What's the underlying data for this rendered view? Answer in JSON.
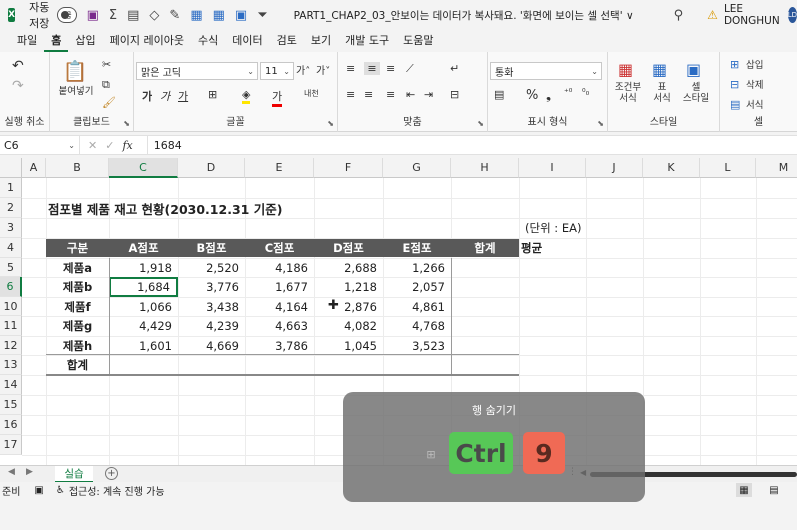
{
  "titlebar": {
    "app_logo": "X",
    "autosave_label": "자동 저장",
    "autosave_state": "끔",
    "doc_title": "PART1_CHAP2_03_안보이는 데이터가 복사돼요. '화면에 보이는 셀 선택' ∨",
    "user_name": "LEE DONGHUN",
    "avatar_initials": "LD"
  },
  "menu": {
    "tabs": [
      "파일",
      "홈",
      "삽입",
      "페이지 레이아웃",
      "수식",
      "데이터",
      "검토",
      "보기",
      "개발 도구",
      "도움말"
    ],
    "active": "홈"
  },
  "ribbon": {
    "undo_label": "실행 취소",
    "clipboard": {
      "paste_label": "붙여넣기",
      "group_label": "클립보드"
    },
    "font": {
      "font_name": "맑은 고딕",
      "font_size": "11",
      "group_label": "글꼴",
      "bold": "가",
      "italic": "가",
      "underline": "가",
      "grow": "가˄",
      "shrink": "가˅"
    },
    "alignment": {
      "group_label": "맞춤"
    },
    "number": {
      "format": "통화",
      "group_label": "표시 형식"
    },
    "styles": {
      "cond_label": "조건부\n서식",
      "table_label": "표\n서식",
      "cell_style_label": "셀\n스타일",
      "group_label": "스타일"
    },
    "cells": {
      "insert_label": "삽입",
      "delete_label": "삭제",
      "format_label": "서식",
      "group_label": "셀"
    }
  },
  "formula_bar": {
    "name_box": "C6",
    "formula": "1684",
    "fx_label": "fx"
  },
  "grid": {
    "columns": [
      "A",
      "B",
      "C",
      "D",
      "E",
      "F",
      "G",
      "H",
      "I",
      "J",
      "K",
      "L",
      "M"
    ],
    "rows": [
      "1",
      "2",
      "3",
      "4",
      "5",
      "6",
      "10",
      "11",
      "12",
      "13",
      "14",
      "15",
      "16",
      "17"
    ],
    "selected_col": "C",
    "selected_row": "6",
    "title": "점포별 제품 재고 현황(2030.12.31 기준)",
    "unit": "(단위 : EA)",
    "avg_label": "평균",
    "headers": [
      "구분",
      "A점포",
      "B점포",
      "C점포",
      "D점포",
      "E점포",
      "합계"
    ],
    "rows_data": [
      {
        "label": "제품a",
        "values": [
          "1,918",
          "2,520",
          "4,186",
          "2,688",
          "1,266"
        ]
      },
      {
        "label": "제품b",
        "values": [
          "1,684",
          "3,776",
          "1,677",
          "1,218",
          "2,057"
        ]
      },
      {
        "label": "제품f",
        "values": [
          "1,066",
          "3,438",
          "4,164",
          "2,876",
          "4,861"
        ]
      },
      {
        "label": "제품g",
        "values": [
          "4,429",
          "4,239",
          "4,663",
          "4,082",
          "4,768"
        ]
      },
      {
        "label": "제품h",
        "values": [
          "1,601",
          "4,669",
          "3,786",
          "1,045",
          "3,523"
        ]
      }
    ],
    "total_label": "합계"
  },
  "sheets": {
    "active": "실습"
  },
  "status": {
    "ready": "준비",
    "accessibility": "접근성: 계속 진행 가능"
  },
  "overlay": {
    "title": "행 숨기기",
    "key1": "Ctrl",
    "key2": "9"
  }
}
